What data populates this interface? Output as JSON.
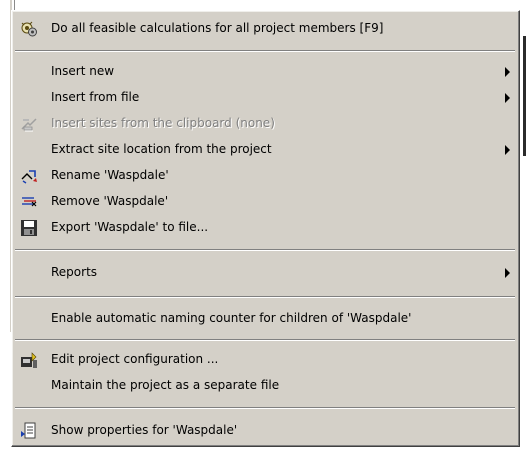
{
  "menu": {
    "items": [
      {
        "label": "Do all feasible calculations for all project members [F9]",
        "icon": "calculator-icon",
        "enabled": true,
        "submenu": false
      },
      {
        "label": "Insert new",
        "icon": "",
        "enabled": true,
        "submenu": true
      },
      {
        "label": "Insert from file",
        "icon": "",
        "enabled": true,
        "submenu": true
      },
      {
        "label": "Insert sites from the clipboard (none)",
        "icon": "clipboard-icon",
        "enabled": false,
        "submenu": false
      },
      {
        "label": "Extract site location from the project",
        "icon": "",
        "enabled": true,
        "submenu": true
      },
      {
        "label": "Rename 'Waspdale'",
        "icon": "rename-icon",
        "enabled": true,
        "submenu": false
      },
      {
        "label": "Remove 'Waspdale'",
        "icon": "remove-icon",
        "enabled": true,
        "submenu": false
      },
      {
        "label": "Export 'Waspdale' to file...",
        "icon": "floppy-disk-icon",
        "enabled": true,
        "submenu": false
      },
      {
        "label": "Reports",
        "icon": "",
        "enabled": true,
        "submenu": true
      },
      {
        "label": "Enable automatic naming counter for children of 'Waspdale'",
        "icon": "",
        "enabled": true,
        "submenu": false
      },
      {
        "label": "Edit project configuration ...",
        "icon": "project-config-icon",
        "enabled": true,
        "submenu": false
      },
      {
        "label": "Maintain the project as a separate file",
        "icon": "",
        "enabled": true,
        "submenu": false
      },
      {
        "label": "Show properties for 'Waspdale'",
        "icon": "properties-icon",
        "enabled": true,
        "submenu": false
      }
    ]
  },
  "colors": {
    "menu_background": "#d4d0c8",
    "disabled_text": "#808080"
  }
}
